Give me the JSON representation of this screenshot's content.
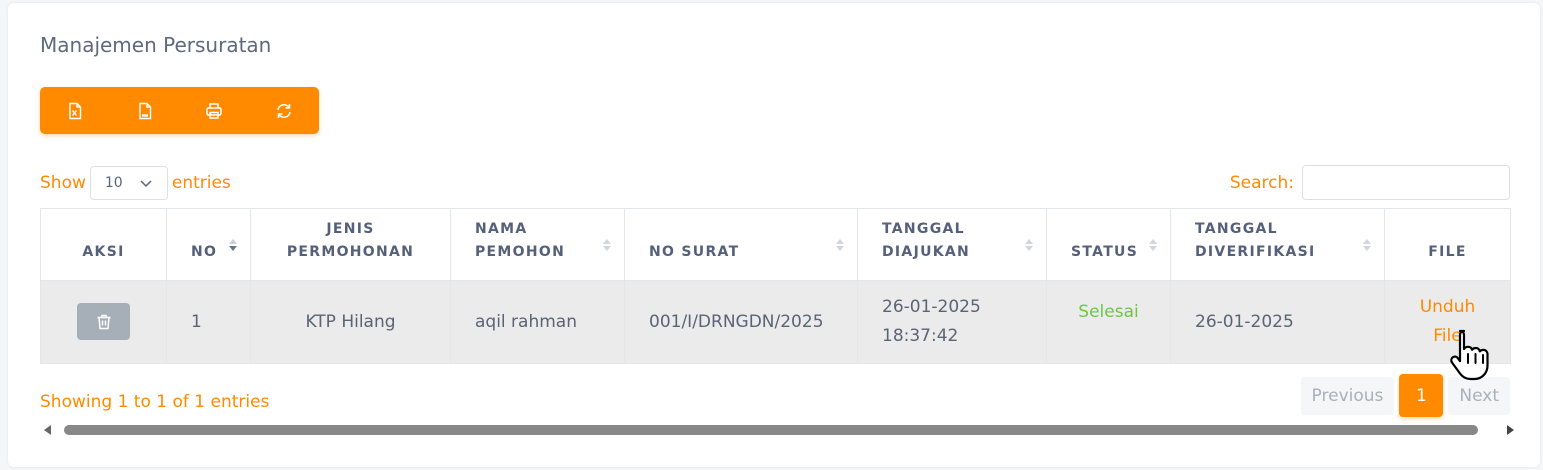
{
  "page": {
    "title": "Manajemen Persuratan"
  },
  "toolbar": {
    "accent": "#ff8a00",
    "buttons": [
      {
        "icon": "file-excel-icon"
      },
      {
        "icon": "file-csv-icon"
      },
      {
        "icon": "printer-icon"
      },
      {
        "icon": "refresh-icon"
      }
    ]
  },
  "length": {
    "show_label": "Show",
    "value": "10",
    "entries_label": "entries"
  },
  "search": {
    "label": "Search:",
    "value": ""
  },
  "table": {
    "columns": [
      "AKSI",
      "NO",
      "JENIS PERMOHONAN",
      "NAMA PEMOHON",
      "NO SURAT",
      "TANGGAL DIAJUKAN",
      "STATUS",
      "TANGGAL DIVERIFIKASI",
      "FILE"
    ],
    "rows": [
      {
        "no": "1",
        "jenis": "KTP Hilang",
        "nama": "aqil rahman",
        "no_surat": "001/I/DRNGDN/2025",
        "tanggal_diajukan": "26-01-2025 18:37:42",
        "status": "Selesai",
        "tanggal_diverifikasi": "26-01-2025",
        "file": "Unduh File"
      }
    ]
  },
  "footer": {
    "info": "Showing 1 to 1 of 1 entries",
    "previous": "Previous",
    "current_page": "1",
    "next": "Next"
  },
  "colors": {
    "status_done": "#6cc644",
    "delete_button": "#a6aeb8"
  }
}
